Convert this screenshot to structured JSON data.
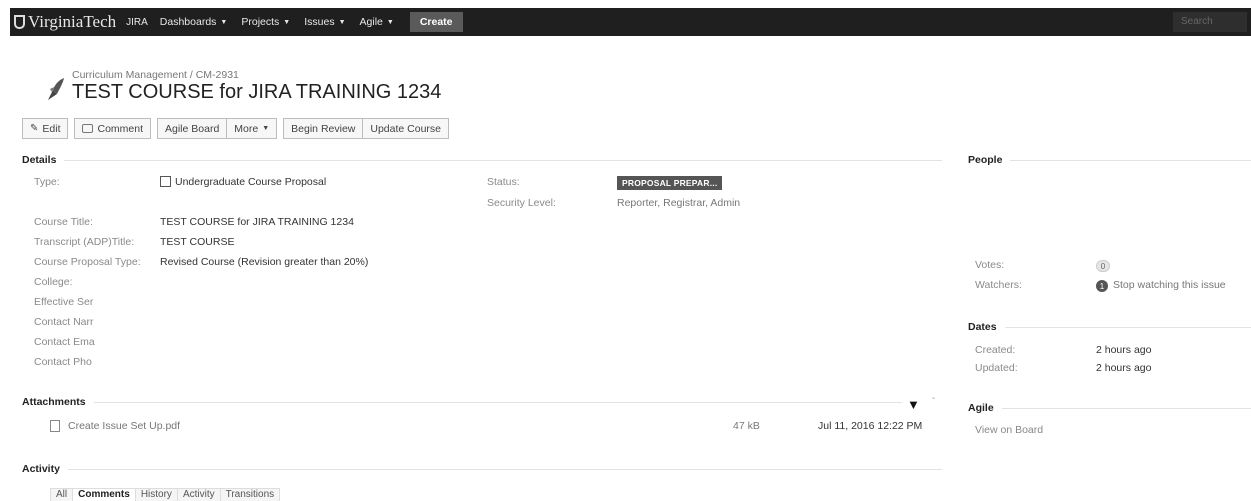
{
  "topnav": {
    "brand": "VirginiaTech",
    "jira": "JIRA",
    "items": [
      "Dashboards",
      "Projects",
      "Issues",
      "Agile"
    ],
    "create": "Create",
    "search_placeholder": "Search"
  },
  "header": {
    "breadcrumb": "Curriculum Management / CM-2931",
    "title": "TEST COURSE for JIRA TRAINING 1234"
  },
  "toolbar": {
    "edit": "Edit",
    "comment": "Comment",
    "agile_board": "Agile Board",
    "more": "More",
    "begin_review": "Begin Review",
    "update_course": "Update Course"
  },
  "details": {
    "heading": "Details",
    "type_label": "Type:",
    "type_value": "Undergraduate Course Proposal",
    "status_label": "Status:",
    "status_value": "PROPOSAL PREPAR...",
    "security_label": "Security Level:",
    "security_value": "Reporter, Registrar, Admin",
    "fields": [
      {
        "label": "Course Title:",
        "value": "TEST COURSE for JIRA TRAINING 1234"
      },
      {
        "label": "Transcript (ADP)Title:",
        "value": "TEST COURSE"
      },
      {
        "label": "Course Proposal Type:",
        "value": "Revised Course (Revision greater than 20%)"
      },
      {
        "label": "College:",
        "value": ""
      },
      {
        "label": "Effective Ser",
        "value": ""
      },
      {
        "label": "Contact Narr",
        "value": ""
      },
      {
        "label": "Contact Ema",
        "value": ""
      },
      {
        "label": "Contact Pho",
        "value": ""
      }
    ]
  },
  "attachments": {
    "heading": "Attachments",
    "file_name": "Create Issue Set Up.pdf",
    "file_size": "47 kB",
    "file_date": "Jul 11, 2016 12:22 PM",
    "dash": "-"
  },
  "activity": {
    "heading": "Activity",
    "tabs": [
      "All",
      "Comments",
      "History",
      "Activity",
      "Transitions"
    ],
    "active_tab": "Comments"
  },
  "people": {
    "heading": "People",
    "votes_label": "Votes:",
    "votes_count": "0",
    "watchers_label": "Watchers:",
    "watchers_count": "1",
    "watch_link": "Stop watching this issue"
  },
  "dates": {
    "heading": "Dates",
    "created_label": "Created:",
    "created_value": "2 hours ago",
    "updated_label": "Updated:",
    "updated_value": "2 hours ago"
  },
  "agile": {
    "heading": "Agile",
    "view_link": "View on Board"
  },
  "colors": {
    "nav_bg": "#1f1f1f",
    "status_bg": "#555555"
  }
}
